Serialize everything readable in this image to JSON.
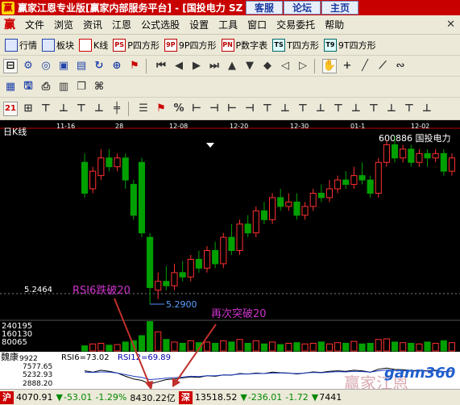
{
  "window": {
    "title": "赢家江恩专业版[赢家内部服务平台] - [国投电力  SZ",
    "buttons": [
      "客服",
      "论坛",
      "主页"
    ]
  },
  "menu": {
    "items": [
      "文件",
      "浏览",
      "资讯",
      "江恩",
      "公式选股",
      "设置",
      "工具",
      "窗口",
      "交易委托",
      "帮助"
    ]
  },
  "toolbar1": {
    "items": [
      "行情",
      "板块",
      "K线",
      "P四方形",
      "9P四方形",
      "P数字表",
      "T四方形",
      "9T四方形"
    ],
    "icon_labels": [
      "PS",
      "9P",
      "PN",
      "TS",
      "T9"
    ]
  },
  "chart": {
    "period_label": "日K线",
    "stock_label": "600886 国投电力",
    "date_ticks": [
      "11-16",
      "28",
      "12-08",
      "12-20",
      "12-30",
      "01-1",
      "12-02"
    ],
    "price_label": "5.2464",
    "low_label": "5.2900",
    "annotation1": "RSI6跌破20",
    "annotation2": "再次突破20",
    "volume_ticks": [
      "240195",
      "160130",
      "80065"
    ],
    "colors": {
      "up": "#ff3030",
      "down": "#00a000",
      "annotation": "#cc33cc",
      "axis": "#c00000"
    },
    "candles": [
      {
        "o": 6.9,
        "c": 6.55,
        "h": 7.0,
        "l": 6.5
      },
      {
        "o": 6.6,
        "c": 6.8,
        "h": 6.85,
        "l": 6.55
      },
      {
        "o": 6.75,
        "c": 6.95,
        "h": 7.05,
        "l": 6.7
      },
      {
        "o": 6.95,
        "c": 6.85,
        "h": 7.05,
        "l": 6.8
      },
      {
        "o": 6.85,
        "c": 6.95,
        "h": 7.0,
        "l": 6.8
      },
      {
        "o": 6.95,
        "c": 6.7,
        "h": 7.0,
        "l": 6.6
      },
      {
        "o": 6.65,
        "c": 6.3,
        "h": 6.7,
        "l": 6.25
      },
      {
        "o": 6.9,
        "c": 6.1,
        "h": 6.95,
        "l": 6.05
      },
      {
        "o": 6.05,
        "c": 5.48,
        "h": 6.1,
        "l": 5.29
      },
      {
        "o": 5.45,
        "c": 5.55,
        "h": 5.65,
        "l": 5.35
      },
      {
        "o": 5.55,
        "c": 5.5,
        "h": 5.72,
        "l": 5.45
      },
      {
        "o": 5.5,
        "c": 5.65,
        "h": 5.75,
        "l": 5.45
      },
      {
        "o": 5.65,
        "c": 5.6,
        "h": 5.78,
        "l": 5.55
      },
      {
        "o": 5.6,
        "c": 5.8,
        "h": 5.85,
        "l": 5.55
      },
      {
        "o": 5.8,
        "c": 5.7,
        "h": 5.9,
        "l": 5.65
      },
      {
        "o": 5.7,
        "c": 5.9,
        "h": 5.95,
        "l": 5.65
      },
      {
        "o": 5.9,
        "c": 5.75,
        "h": 6.0,
        "l": 5.7
      },
      {
        "o": 5.75,
        "c": 6.05,
        "h": 6.1,
        "l": 5.7
      },
      {
        "o": 6.05,
        "c": 5.9,
        "h": 6.2,
        "l": 5.85
      },
      {
        "o": 5.9,
        "c": 6.2,
        "h": 6.25,
        "l": 5.85
      },
      {
        "o": 6.2,
        "c": 6.1,
        "h": 6.3,
        "l": 6.05
      },
      {
        "o": 6.1,
        "c": 6.35,
        "h": 6.4,
        "l": 6.05
      },
      {
        "o": 6.35,
        "c": 6.25,
        "h": 6.45,
        "l": 6.2
      },
      {
        "o": 6.25,
        "c": 6.5,
        "h": 6.55,
        "l": 6.2
      },
      {
        "o": 6.5,
        "c": 6.4,
        "h": 6.6,
        "l": 6.35
      },
      {
        "o": 6.4,
        "c": 6.45,
        "h": 6.55,
        "l": 6.35
      },
      {
        "o": 6.45,
        "c": 6.3,
        "h": 6.55,
        "l": 6.25
      },
      {
        "o": 6.3,
        "c": 6.4,
        "h": 6.45,
        "l": 6.25
      },
      {
        "o": 6.4,
        "c": 6.55,
        "h": 6.6,
        "l": 6.35
      },
      {
        "o": 6.55,
        "c": 6.5,
        "h": 6.65,
        "l": 6.45
      },
      {
        "o": 6.5,
        "c": 6.6,
        "h": 6.7,
        "l": 6.45
      },
      {
        "o": 6.6,
        "c": 6.7,
        "h": 6.75,
        "l": 6.55
      },
      {
        "o": 6.7,
        "c": 6.65,
        "h": 6.8,
        "l": 6.6
      },
      {
        "o": 6.65,
        "c": 6.75,
        "h": 6.85,
        "l": 6.6
      },
      {
        "o": 6.75,
        "c": 6.7,
        "h": 6.9,
        "l": 6.65
      },
      {
        "o": 6.7,
        "c": 6.55,
        "h": 6.75,
        "l": 6.5
      },
      {
        "o": 6.55,
        "c": 6.9,
        "h": 6.95,
        "l": 6.5
      },
      {
        "o": 6.9,
        "c": 7.1,
        "h": 7.15,
        "l": 6.85
      },
      {
        "o": 7.1,
        "c": 6.95,
        "h": 7.2,
        "l": 6.9
      },
      {
        "o": 6.95,
        "c": 7.05,
        "h": 7.1,
        "l": 6.9
      },
      {
        "o": 7.05,
        "c": 6.9,
        "h": 7.1,
        "l": 6.85
      },
      {
        "o": 6.9,
        "c": 7.0,
        "h": 7.05,
        "l": 6.85
      },
      {
        "o": 7.0,
        "c": 6.95,
        "h": 7.05,
        "l": 6.85
      },
      {
        "o": 6.95,
        "c": 7.0,
        "h": 7.05,
        "l": 6.9
      },
      {
        "o": 7.0,
        "c": 6.8,
        "h": 7.05,
        "l": 6.75
      },
      {
        "o": 6.8,
        "c": 6.95,
        "h": 7.0,
        "l": 6.75
      }
    ],
    "volumes": [
      40,
      55,
      60,
      45,
      50,
      70,
      80,
      120,
      230,
      150,
      90,
      70,
      60,
      80,
      65,
      70,
      60,
      80,
      70,
      90,
      60,
      80,
      55,
      70,
      50,
      60,
      65,
      55,
      60,
      70,
      55,
      65,
      60,
      75,
      55,
      60,
      90,
      95,
      70,
      65,
      60,
      55,
      70,
      60,
      80,
      65
    ],
    "rsi6": [
      60,
      55,
      62,
      58,
      52,
      40,
      30,
      25,
      12,
      20,
      28,
      30,
      34,
      38,
      36,
      42,
      40,
      45,
      44,
      50,
      48,
      52,
      50,
      55,
      53,
      52,
      48,
      52,
      56,
      54,
      58,
      60,
      58,
      62,
      60,
      55,
      66,
      70,
      65,
      64,
      60,
      62,
      60,
      62,
      56,
      60
    ],
    "rsi12": [
      55,
      54,
      56,
      55,
      52,
      46,
      40,
      36,
      28,
      30,
      33,
      35,
      37,
      40,
      39,
      42,
      42,
      45,
      45,
      48,
      48,
      50,
      50,
      52,
      52,
      51,
      50,
      52,
      54,
      53,
      55,
      57,
      56,
      58,
      57,
      55,
      60,
      63,
      61,
      60,
      59,
      60,
      59,
      60,
      57,
      59
    ]
  },
  "indicator": {
    "name": "魏康",
    "ticks": [
      "9922",
      "7577.65",
      "5232.93",
      "2888.20"
    ],
    "legend_rsi6": "RSI6=73.02",
    "legend_rsi12": "RSI12=69.89"
  },
  "statusbar": {
    "tag": "沪",
    "index": "4070.91",
    "change": "-53.01",
    "pct": "-1.29%",
    "volume": "8430.22亿",
    "tag2": "深",
    "index2": "13518.52",
    "change2": "-236.01",
    "pct2": "-1.72",
    "volume2": "7441"
  },
  "watermark": {
    "brand": "gann360",
    "ghost": "赢家江恩"
  }
}
